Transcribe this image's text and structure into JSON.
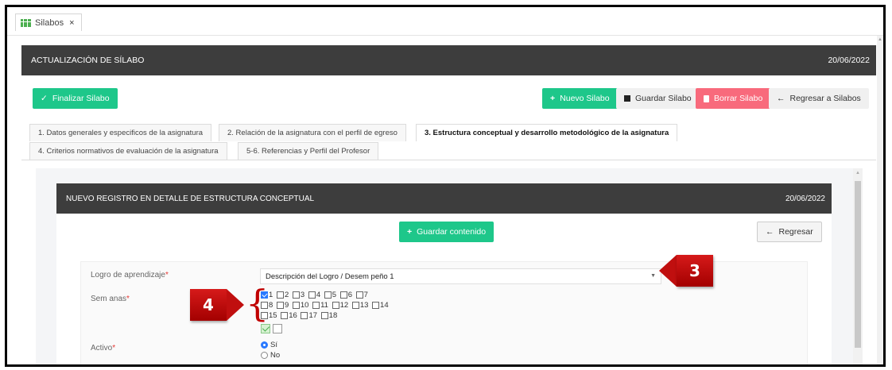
{
  "tab": {
    "title": "Silabos",
    "close": "×"
  },
  "header": {
    "title": "ACTUALIZACIÓN DE SÍLABO",
    "date": "20/06/2022"
  },
  "toolbar": {
    "finalize": "Finalizar Silabo",
    "new": "Nuevo Silabo",
    "save": "Guardar Silabo",
    "delete": "Borrar Silabo",
    "back": "Regresar a Silabos"
  },
  "sections": [
    "1. Datos generales y especificos de la asignatura",
    "2. Relación de la asignatura con el perfil de egreso",
    "3. Estructura conceptual y desarrollo metodológico de la asignatura",
    "4. Criterios normativos de evaluación de la asignatura",
    "5-6. Referencias y Perfil del Profesor"
  ],
  "inner": {
    "title": "NUEVO REGISTRO EN DETALLE DE ESTRUCTURA CONCEPTUAL",
    "date": "20/06/2022",
    "save_content": "Guardar contenido",
    "back": "Regresar"
  },
  "form": {
    "logro_label": "Logro de aprendizaje",
    "logro_value": "Descripción del Logro / Desem peño 1",
    "semanas_label": "Sem anas",
    "weeks": [
      "1",
      "2",
      "3",
      "4",
      "5",
      "6",
      "7",
      "8",
      "9",
      "10",
      "11",
      "12",
      "13",
      "14",
      "15",
      "16",
      "17",
      "18"
    ],
    "checked_week": "1",
    "activo_label": "Activo",
    "si": "Sí",
    "no": "No",
    "required_mark": "*"
  },
  "callouts": {
    "three": "3",
    "four": "4"
  },
  "colors": {
    "accent_green": "#1ec78a",
    "danger": "#f86a7c",
    "header_dark": "#3d3d3d",
    "callout_red": "#c00f0f"
  }
}
